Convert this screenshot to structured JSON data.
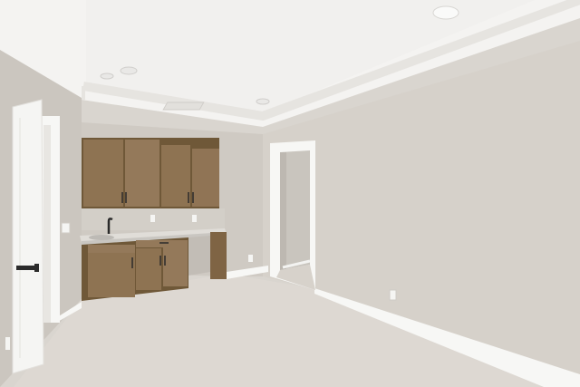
{
  "scene": {
    "description_tag": "room-photo",
    "colors": {
      "ceiling": "#f4f3f1",
      "wall_right": "#d6d1ca",
      "wall_back": "#cfcac3",
      "wall_left": "#cbc6bf",
      "carpet": "#ddd8d2",
      "trim": "#f7f7f5",
      "cabinet": "#8e7352",
      "cabinet_dark": "#6f5838",
      "counter": "#d8d6d2",
      "door": "#f5f5f3",
      "hardware": "#2b2b2b"
    }
  }
}
